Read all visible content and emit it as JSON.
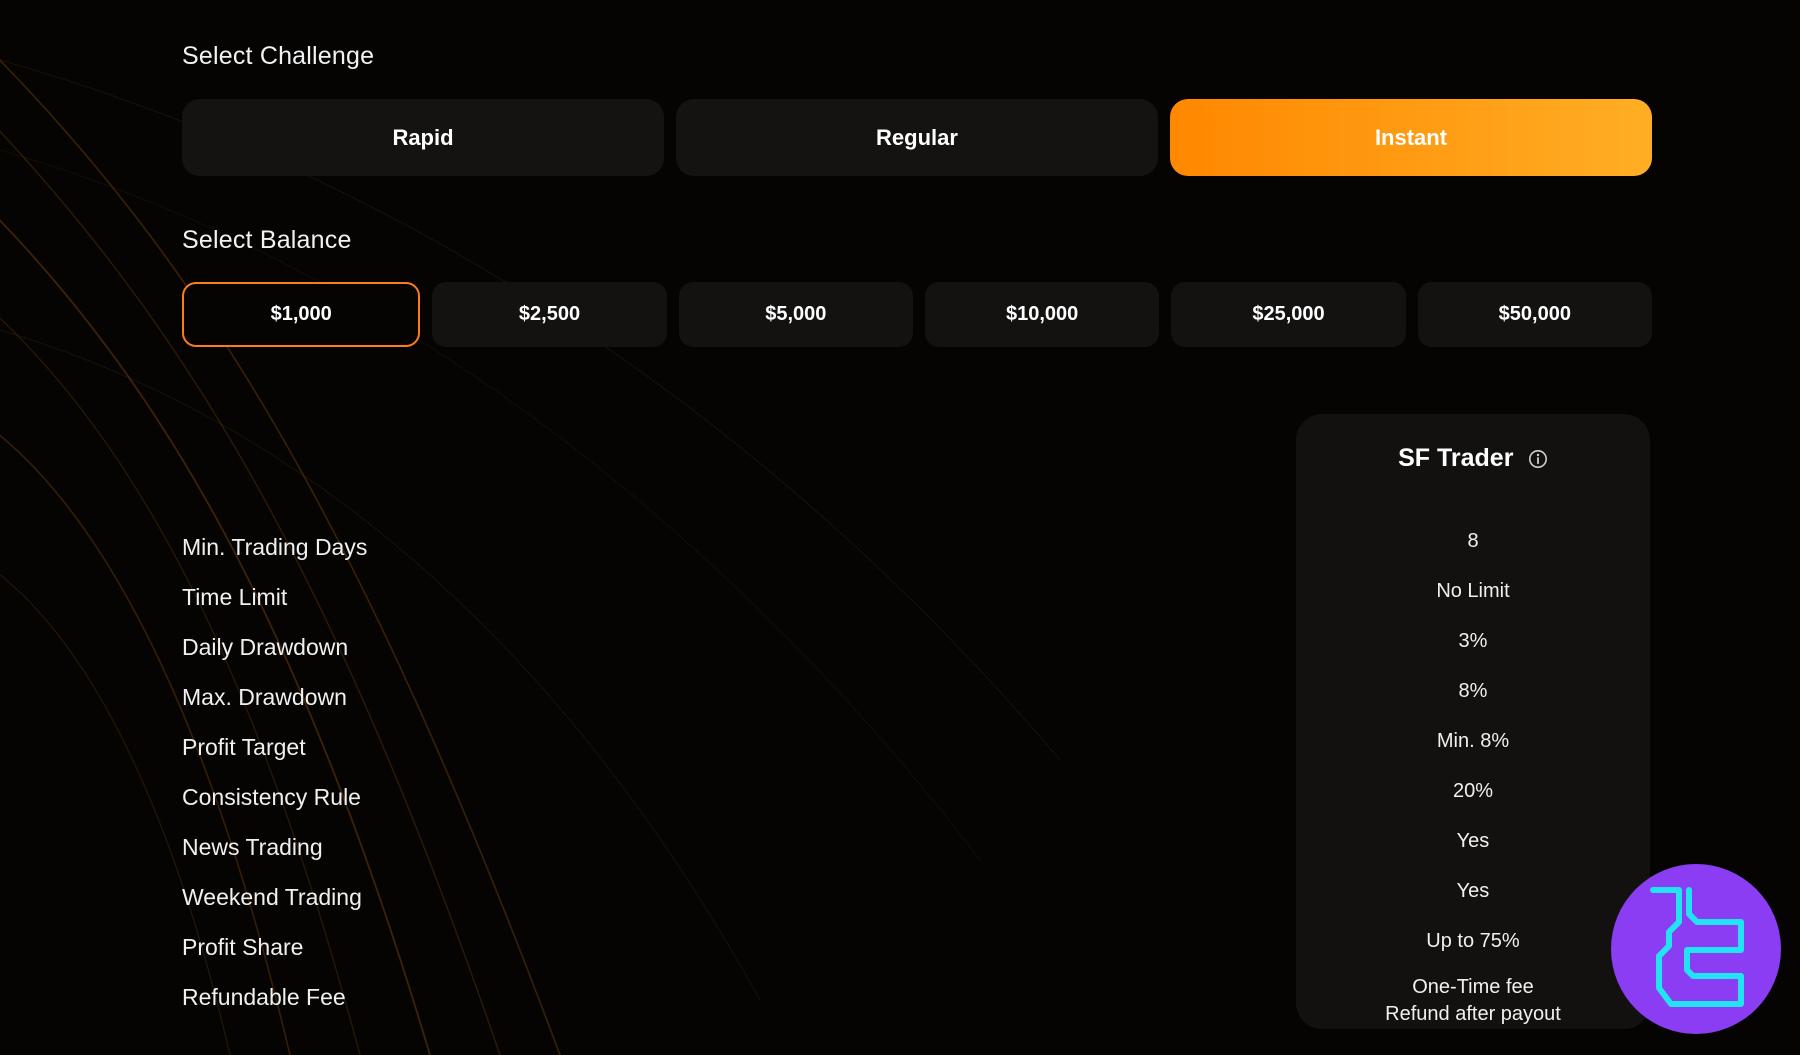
{
  "challenge": {
    "title": "Select Challenge",
    "options": [
      {
        "label": "Rapid",
        "active": false
      },
      {
        "label": "Regular",
        "active": false
      },
      {
        "label": "Instant",
        "active": true
      }
    ]
  },
  "balance": {
    "title": "Select Balance",
    "options": [
      {
        "label": "$1,000",
        "active": true
      },
      {
        "label": "$2,500",
        "active": false
      },
      {
        "label": "$5,000",
        "active": false
      },
      {
        "label": "$10,000",
        "active": false
      },
      {
        "label": "$25,000",
        "active": false
      },
      {
        "label": "$50,000",
        "active": false
      }
    ]
  },
  "plan": {
    "name": "SF Trader",
    "info_icon": "info-circle-icon"
  },
  "rules": [
    {
      "label": "Min. Trading Days",
      "value": "8"
    },
    {
      "label": "Time Limit",
      "value": "No Limit"
    },
    {
      "label": "Daily Drawdown",
      "value": "3%"
    },
    {
      "label": "Max. Drawdown",
      "value": "8%"
    },
    {
      "label": "Profit Target",
      "value": "Min. 8%"
    },
    {
      "label": "Consistency Rule",
      "value": "20%"
    },
    {
      "label": "News Trading",
      "value": "Yes"
    },
    {
      "label": "Weekend Trading",
      "value": "Yes"
    },
    {
      "label": "Profit Share",
      "value": "Up to 75%"
    },
    {
      "label": "Refundable Fee",
      "value_line1": "One-Time fee",
      "value_line2": "Refund after payout"
    }
  ],
  "colors": {
    "accent": "#ff8800",
    "accent_end": "#ffae24",
    "active_border": "#ff7a1a",
    "background": "#050403",
    "card": "#121110",
    "watermark_bg": "#8a3df2",
    "watermark_glyph": "#22e3f2"
  },
  "watermark": {
    "icon": "logo-icon"
  }
}
